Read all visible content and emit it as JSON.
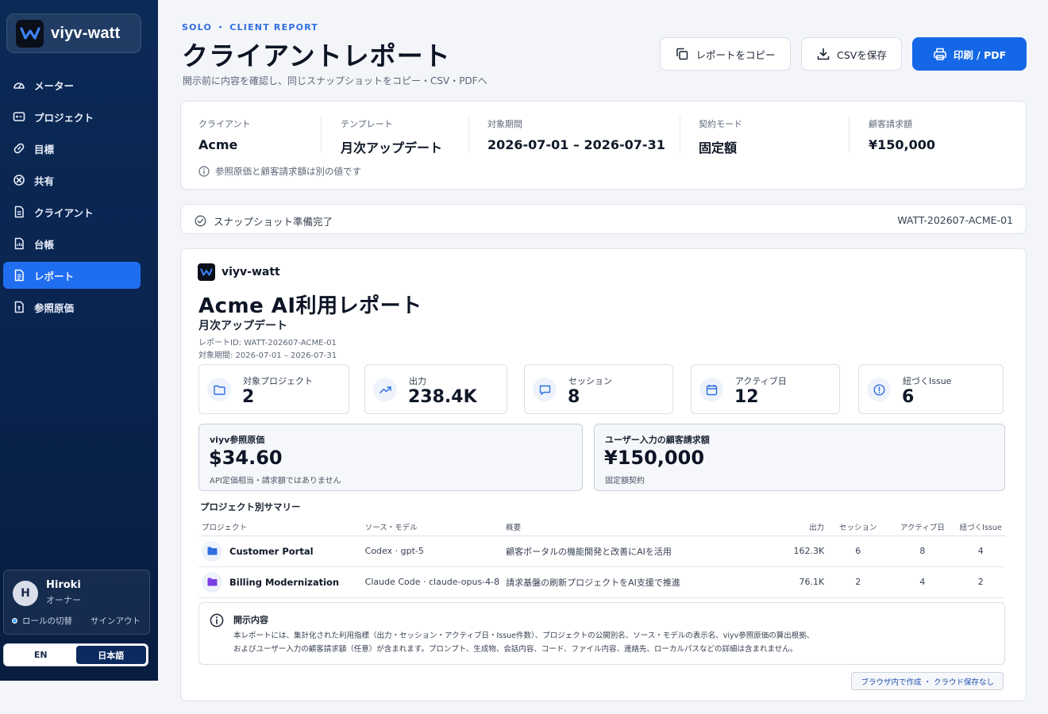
{
  "app": {
    "name": "viyv-watt"
  },
  "sidebar": {
    "items": [
      {
        "label": "メーター",
        "icon": "gauge-icon"
      },
      {
        "label": "プロジェクト",
        "icon": "project-icon"
      },
      {
        "label": "目標",
        "icon": "link-icon"
      },
      {
        "label": "共有",
        "icon": "share-icon"
      },
      {
        "label": "クライアント",
        "icon": "document-icon"
      },
      {
        "label": "台帳",
        "icon": "ledger-icon"
      },
      {
        "label": "レポート",
        "icon": "report-icon",
        "active": true
      },
      {
        "label": "参照原価",
        "icon": "cost-icon"
      }
    ],
    "user": {
      "initial": "H",
      "name": "Hiroki",
      "role": "オーナー",
      "switch_role": "ロールの切替",
      "signout": "サインアウト"
    },
    "lang": {
      "en": "EN",
      "ja": "日本語",
      "selected": "ja"
    }
  },
  "header": {
    "eyebrow": "SOLO ・ CLIENT REPORT",
    "title": "クライアントレポート",
    "subtitle": "開示前に内容を確認し、同じスナップショットをコピー・CSV・PDFへ",
    "copy_btn": "レポートをコピー",
    "csv_btn": "CSVを保存",
    "print_btn": "印刷 / PDF"
  },
  "meta": {
    "client_label": "クライアント",
    "client": "Acme",
    "template_label": "テンプレート",
    "template": "月次アップデート",
    "period_label": "対象期間",
    "period": "2026-07-01 – 2026-07-31",
    "contract_label": "契約モード",
    "contract": "固定額",
    "billing_label": "顧客請求額",
    "billing": "¥150,000",
    "note": "参照原価と顧客請求額は別の値です"
  },
  "snapshot": {
    "status": "スナップショット準備完了",
    "id": "WATT-202607-ACME-01"
  },
  "report": {
    "brand": "viyv-watt",
    "title": "Acme AI利用レポート",
    "subtitle": "月次アップデート",
    "report_id": "レポートID: WATT-202607-ACME-01",
    "period": "対象期間: 2026-07-01 – 2026-07-31",
    "stats": [
      {
        "label": "対象プロジェクト",
        "value": "2",
        "icon": "folder-icon"
      },
      {
        "label": "出力",
        "value": "238.4K",
        "icon": "trend-icon"
      },
      {
        "label": "セッション",
        "value": "8",
        "icon": "chat-icon"
      },
      {
        "label": "アクティブ日",
        "value": "12",
        "icon": "calendar-icon"
      },
      {
        "label": "紐づくIssue",
        "value": "6",
        "icon": "alert-icon"
      }
    ],
    "ref_cost": {
      "label": "viyv参照原価",
      "value": "$34.60",
      "note": "API定価相当・請求額ではありません"
    },
    "client_bill": {
      "label": "ユーザー入力の顧客請求額",
      "value": "¥150,000",
      "note": "固定額契約"
    },
    "summary_title": "プロジェクト別サマリー",
    "columns": [
      "プロジェクト",
      "ソース・モデル",
      "概要",
      "出力",
      "セッション",
      "アクティブ日",
      "紐づくIssue"
    ],
    "rows": [
      {
        "name": "Customer Portal",
        "source": "Codex · gpt-5",
        "desc": "顧客ポータルの機能開発と改善にAIを活用",
        "output": "162.3K",
        "sessions": "6",
        "days": "8",
        "issues": "4",
        "color": "#2f6fe0"
      },
      {
        "name": "Billing Modernization",
        "source": "Claude Code · claude-opus-4-8",
        "desc": "請求基盤の刷新プロジェクトをAI支援で推進",
        "output": "76.1K",
        "sessions": "2",
        "days": "4",
        "issues": "2",
        "color": "#7b3fe4"
      }
    ],
    "disclosure_title": "開示内容",
    "disclosure_line1": "本レポートには、集計化された利用指標（出力・セッション・アクティブ日・Issue件数）、プロジェクトの公開別名、ソース・モデルの表示名、viyv参照原価の算出根拠、",
    "disclosure_line2": "およびユーザー入力の顧客請求額（任意）が含まれます。プロンプト、生成物、会話内容、コード、ファイル内容、連絡先、ローカルパスなどの詳細は含まれません。",
    "local_badge": "ブラウザ内で作成 ・ クラウド保存なし"
  },
  "colors": {
    "accent": "#1467e6",
    "sidebar": "#0b2a55"
  }
}
